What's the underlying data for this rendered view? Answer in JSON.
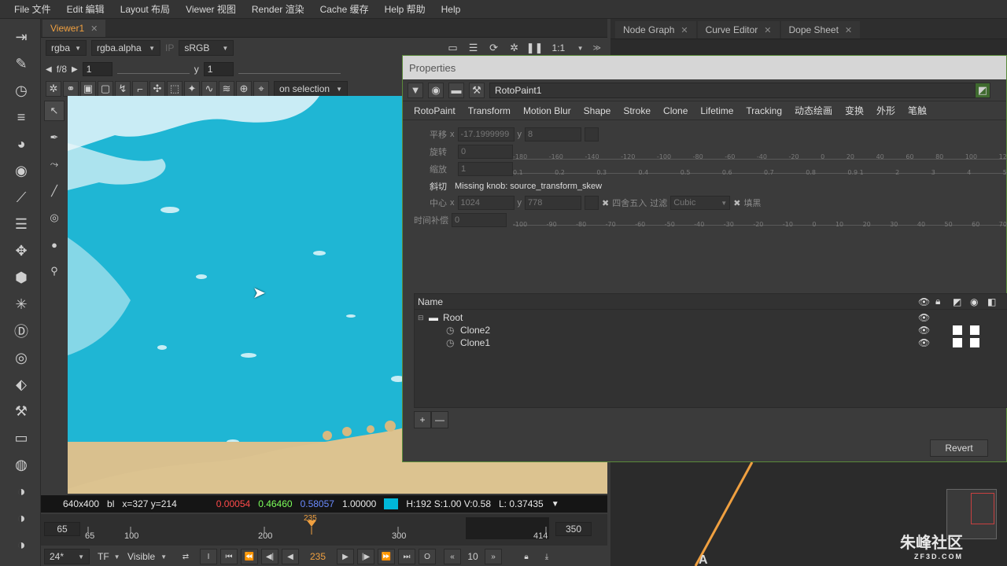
{
  "menu": [
    "File 文件",
    "Edit 編辑",
    "Layout 布局",
    "Viewer 视图",
    "Render 渲染",
    "Cache 缓存",
    "Help 帮助",
    "Help"
  ],
  "viewer": {
    "tab_label": "Viewer1",
    "channels": "rgba",
    "alpha": "rgba.alpha",
    "ip_label": "IP",
    "colorspace": "sRGB",
    "zoom": "1:1",
    "fstop": "f/8",
    "gain_value": "1",
    "gamma_label": "y",
    "gamma_value": "1",
    "selection_mode": "on selection",
    "info": {
      "resolution": "640x400",
      "channel": "bl",
      "coords": "x=327 y=214",
      "r": "0.00054",
      "g": "0.46460",
      "b": "0.58057",
      "a": "1.00000",
      "hsv": "H:192 S:1.00 V:0.58",
      "lum": "L: 0.37435",
      "swatch_color": "#00b7d8"
    },
    "timeline": {
      "in": "65",
      "out": "350",
      "current": "235",
      "start_tick": "65",
      "ticks": [
        "100",
        "200",
        "300"
      ],
      "end_tick": "414"
    },
    "transport": {
      "fps": "24*",
      "tf": "TF",
      "visible": "Visible",
      "in_btn": "I",
      "frame": "235",
      "out_btn": "O",
      "step": "10"
    }
  },
  "right_tabs": [
    "Node Graph",
    "Curve Editor",
    "Dope Sheet"
  ],
  "properties": {
    "title": "Properties",
    "node_name": "RotoPaint1",
    "tabs": [
      "RotoPaint",
      "Transform",
      "Motion Blur",
      "Shape",
      "Stroke",
      "Clone",
      "Lifetime",
      "Tracking",
      "动态绘画",
      "变换",
      "外形",
      "笔触"
    ],
    "translate": {
      "label": "平移",
      "x_label": "x",
      "x": "-17.1999999",
      "y_label": "y",
      "y": "8"
    },
    "rotate": {
      "label": "旋转",
      "value": "0",
      "ticks": [
        "-180",
        "-160",
        "-140",
        "-120",
        "-100",
        "-80",
        "-60",
        "-40",
        "-20",
        "0",
        "20",
        "40",
        "60",
        "80",
        "100",
        "12"
      ]
    },
    "scale": {
      "label": "缩放",
      "value": "1",
      "ticks": [
        "0.1",
        "0.2",
        "0.3",
        "0.4",
        "0.5",
        "0.6",
        "0.7",
        "0.8",
        "0.9 1",
        "2",
        "3",
        "4",
        "5"
      ]
    },
    "skew": {
      "label": "斜切",
      "message": "Missing knob: source_transform_skew"
    },
    "center": {
      "label": "中心",
      "x_label": "x",
      "x": "1024",
      "y_label": "y",
      "y": "778",
      "round_label": "四舍五入",
      "filter_label": "过滤",
      "filter": "Cubic",
      "pad_label": "填黑"
    },
    "time_offset": {
      "label": "时间补偿",
      "value": "0",
      "ticks": [
        "-100",
        "-90",
        "-80",
        "-70",
        "-60",
        "-50",
        "-40",
        "-30",
        "-20",
        "-10",
        "0",
        "10",
        "20",
        "30",
        "40",
        "50",
        "60",
        "70"
      ]
    },
    "tree": {
      "header": "Name",
      "rows": [
        {
          "label": "Root",
          "kind": "folder"
        },
        {
          "label": "Clone2",
          "kind": "clone"
        },
        {
          "label": "Clone1",
          "kind": "clone"
        }
      ]
    },
    "add_btn": "+",
    "remove_btn": "—",
    "revert_label": "Revert"
  },
  "graph": {
    "node_label": "A"
  },
  "watermark": {
    "text": "朱峰社区",
    "sub": "ZF3D.COM"
  }
}
